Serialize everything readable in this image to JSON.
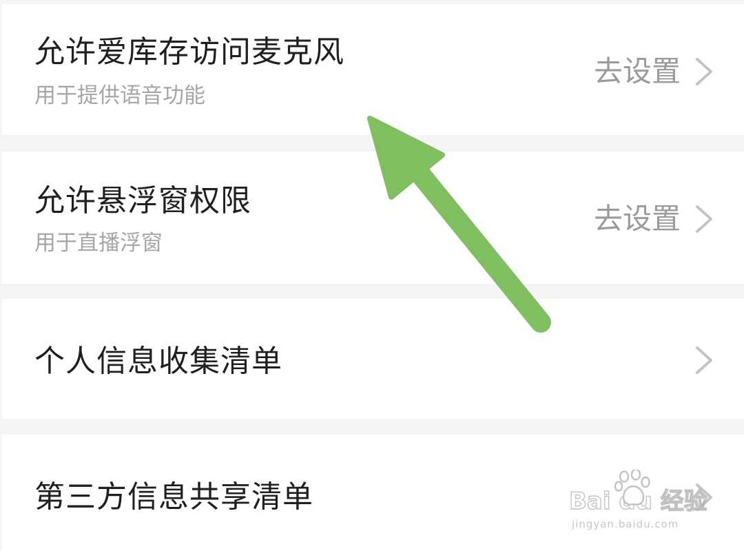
{
  "settings": {
    "items": [
      {
        "title": "允许爱库存访问麦克风",
        "subtitle": "用于提供语音功能",
        "action": "去设置"
      },
      {
        "title": "允许悬浮窗权限",
        "subtitle": "用于直播浮窗",
        "action": "去设置"
      },
      {
        "title": "个人信息收集清单"
      },
      {
        "title": "第三方信息共享清单"
      }
    ]
  },
  "watermark": {
    "brand": "Bai du 经验",
    "url": "jingyan.baidu.com"
  },
  "colors": {
    "arrow": "#80bf5f",
    "title": "#1f1f1f",
    "subtitle": "#a6a6a6",
    "action": "#9a9a9a",
    "divider": "#f5f5f5"
  },
  "icons": {
    "chevron": "chevron-right-icon",
    "annotation": "arrow-annotation-icon",
    "watermark": "paw-icon"
  }
}
